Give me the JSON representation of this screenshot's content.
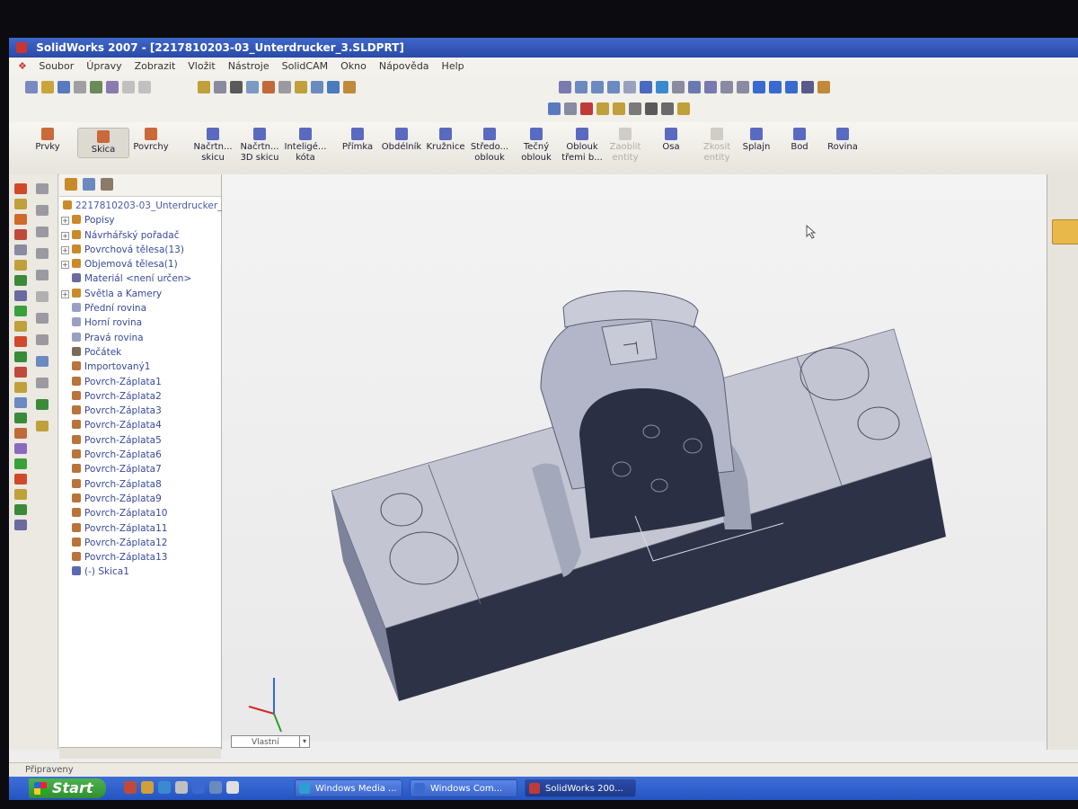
{
  "window": {
    "title": "SolidWorks 2007 - [2217810203-03_Unterdrucker_3.SLDPRT]"
  },
  "menu": [
    "Soubor",
    "Úpravy",
    "Zobrazit",
    "Vložit",
    "Nástroje",
    "SolidCAM",
    "Okno",
    "Nápověda",
    "Help"
  ],
  "commands": [
    {
      "label": "Prvky",
      "state": "normal"
    },
    {
      "label": "Skica",
      "state": "active"
    },
    {
      "label": "Povrchy",
      "state": "normal"
    },
    {
      "label": "Načrtn... skicu",
      "state": "normal"
    },
    {
      "label": "Načrtn... 3D skicu",
      "state": "normal"
    },
    {
      "label": "Inteligé... kóta",
      "state": "normal"
    },
    {
      "label": "Přímka",
      "state": "normal"
    },
    {
      "label": "Obdélník",
      "state": "normal"
    },
    {
      "label": "Kružnice",
      "state": "normal"
    },
    {
      "label": "Středo... oblouk",
      "state": "normal"
    },
    {
      "label": "Tečný oblouk",
      "state": "normal"
    },
    {
      "label": "Oblouk třemi b...",
      "state": "normal"
    },
    {
      "label": "Zaoblit entity",
      "state": "disabled"
    },
    {
      "label": "Osa",
      "state": "normal"
    },
    {
      "label": "Zkosit entity",
      "state": "disabled"
    },
    {
      "label": "Splajn",
      "state": "normal"
    },
    {
      "label": "Bod",
      "state": "normal"
    },
    {
      "label": "Rovina",
      "state": "normal"
    }
  ],
  "tree": {
    "root": "2217810203-03_Unterdrucker_",
    "items": [
      {
        "label": "Popisy",
        "color": "#c98a2a",
        "expand": true
      },
      {
        "label": "Návrhářský pořadač",
        "color": "#c98a2a",
        "expand": true
      },
      {
        "label": "Povrchová tělesa(13)",
        "color": "#c98a2a",
        "expand": true
      },
      {
        "label": "Objemová tělesa(1)",
        "color": "#c98a2a",
        "expand": true
      },
      {
        "label": "Materiál <není určen>",
        "color": "#6a6aa0",
        "expand": false
      },
      {
        "label": "Světla a Kamery",
        "color": "#c98a2a",
        "expand": true
      },
      {
        "label": "Přední rovina",
        "color": "#9aa0c0",
        "expand": false
      },
      {
        "label": "Horní rovina",
        "color": "#9aa0c0",
        "expand": false
      },
      {
        "label": "Pravá rovina",
        "color": "#9aa0c0",
        "expand": false
      },
      {
        "label": "Počátek",
        "color": "#7a6a5a",
        "expand": false
      },
      {
        "label": "Importovaný1",
        "color": "#b8743a",
        "expand": false
      },
      {
        "label": "Povrch-Záplata1",
        "color": "#b8743a",
        "expand": false
      },
      {
        "label": "Povrch-Záplata2",
        "color": "#b8743a",
        "expand": false
      },
      {
        "label": "Povrch-Záplata3",
        "color": "#b8743a",
        "expand": false
      },
      {
        "label": "Povrch-Záplata4",
        "color": "#b8743a",
        "expand": false
      },
      {
        "label": "Povrch-Záplata5",
        "color": "#b8743a",
        "expand": false
      },
      {
        "label": "Povrch-Záplata6",
        "color": "#b8743a",
        "expand": false
      },
      {
        "label": "Povrch-Záplata7",
        "color": "#b8743a",
        "expand": false
      },
      {
        "label": "Povrch-Záplata8",
        "color": "#b8743a",
        "expand": false
      },
      {
        "label": "Povrch-Záplata9",
        "color": "#b8743a",
        "expand": false
      },
      {
        "label": "Povrch-Záplata10",
        "color": "#b8743a",
        "expand": false
      },
      {
        "label": "Povrch-Záplata11",
        "color": "#b8743a",
        "expand": false
      },
      {
        "label": "Povrch-Záplata12",
        "color": "#b8743a",
        "expand": false
      },
      {
        "label": "Povrch-Záplata13",
        "color": "#b8743a",
        "expand": false
      },
      {
        "label": "(-) Skica1",
        "color": "#5a6ab0",
        "expand": false
      }
    ]
  },
  "viewport": {
    "display_state": "Vlastní"
  },
  "status": {
    "text": "Připraveny"
  },
  "taskbar": {
    "start_label": "Start",
    "tasks": [
      {
        "label": "Windows Media ...",
        "active": false
      },
      {
        "label": "Windows Com...",
        "active": false
      },
      {
        "label": "SolidWorks 200...",
        "active": true
      }
    ]
  },
  "colors": {
    "model_face": "#b9bcc9",
    "model_dark": "#2e3246",
    "accent": "#2a4aa8"
  }
}
